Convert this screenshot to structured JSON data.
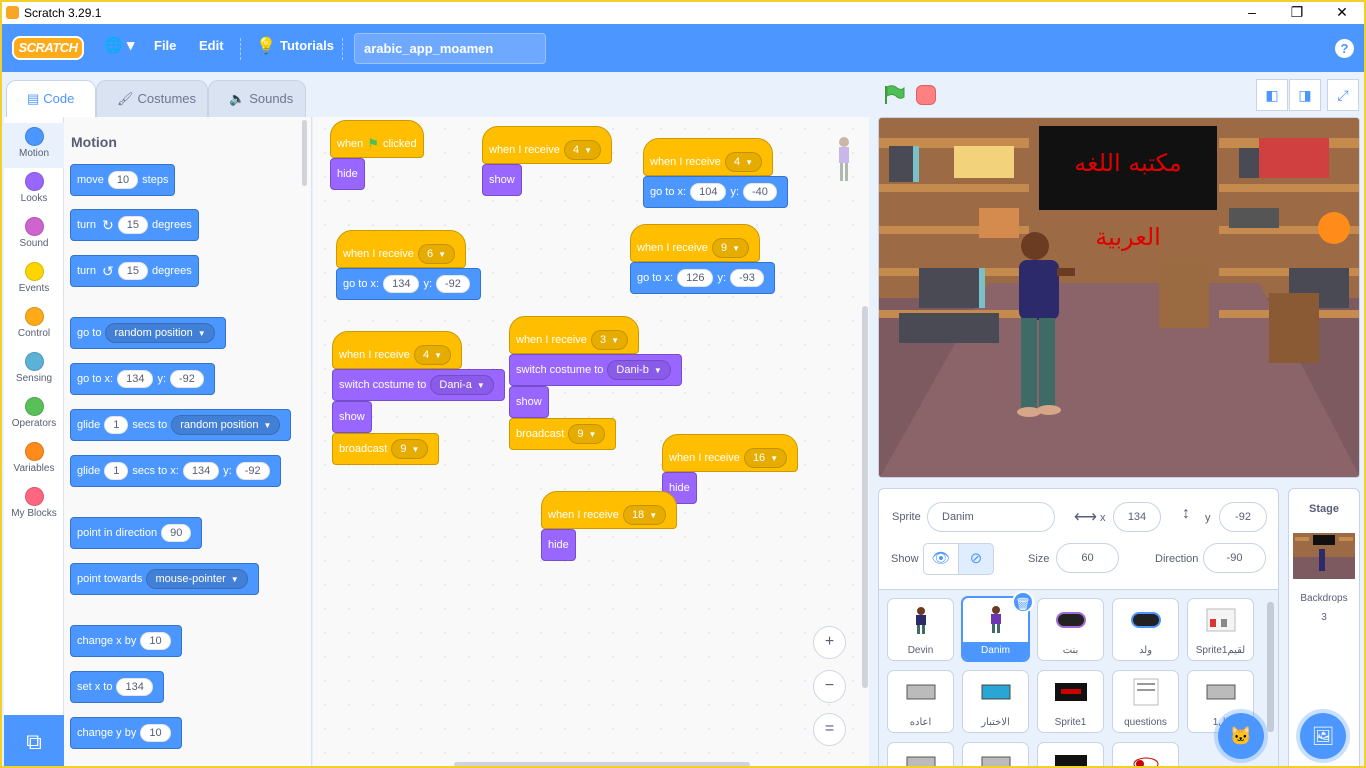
{
  "window": {
    "title": "Scratch 3.29.1",
    "minimize": "–",
    "restore": "❐",
    "close": "✕"
  },
  "menu": {
    "logo": "SCRATCH",
    "globe": "🌐 ▾",
    "file": "File",
    "edit": "Edit",
    "tutorials": "Tutorials",
    "project_name": "arabic_app_moamen",
    "help": "?"
  },
  "tabs": {
    "code": "Code",
    "costumes": "Costumes",
    "sounds": "Sounds"
  },
  "categories": [
    {
      "label": "Motion",
      "color": "#4c97ff"
    },
    {
      "label": "Looks",
      "color": "#9966ff"
    },
    {
      "label": "Sound",
      "color": "#cf63cf"
    },
    {
      "label": "Events",
      "color": "#ffd500"
    },
    {
      "label": "Control",
      "color": "#ffab19"
    },
    {
      "label": "Sensing",
      "color": "#5cb1d6"
    },
    {
      "label": "Operators",
      "color": "#59c059"
    },
    {
      "label": "Variables",
      "color": "#ff8c1a"
    },
    {
      "label": "My Blocks",
      "color": "#ff6680"
    }
  ],
  "palette": {
    "heading": "Motion",
    "move": {
      "a": "move",
      "v": "10",
      "b": "steps"
    },
    "turn_cw": {
      "a": "turn",
      "icon": "↻",
      "v": "15",
      "b": "degrees"
    },
    "turn_ccw": {
      "a": "turn",
      "icon": "↺",
      "v": "15",
      "b": "degrees"
    },
    "goto": {
      "a": "go to",
      "v": "random position"
    },
    "gotoxy": {
      "a": "go to x:",
      "x": "134",
      "b": "y:",
      "y": "-92"
    },
    "glide_to": {
      "a": "glide",
      "v": "1",
      "b": "secs to",
      "t": "random position"
    },
    "glide_xy": {
      "a": "glide",
      "v": "1",
      "b": "secs to x:",
      "x": "134",
      "c": "y:",
      "y": "-92"
    },
    "point_dir": {
      "a": "point in direction",
      "v": "90"
    },
    "point_towards": {
      "a": "point towards",
      "v": "mouse-pointer"
    },
    "change_x": {
      "a": "change x by",
      "v": "10"
    },
    "set_x": {
      "a": "set x to",
      "v": "134"
    },
    "change_y": {
      "a": "change y by",
      "v": "10"
    }
  },
  "scripts": {
    "s1": {
      "hat_a": "when",
      "hat_b": "clicked",
      "b1": "hide"
    },
    "s2": {
      "hat": "when I receive",
      "msg": "4",
      "b1": "show"
    },
    "s3": {
      "hat": "when I receive",
      "msg": "4",
      "b1a": "go to x:",
      "x": "104",
      "b1b": "y:",
      "y": "-40"
    },
    "s4": {
      "hat": "when I receive",
      "msg": "6",
      "b1a": "go to x:",
      "x": "134",
      "b1b": "y:",
      "y": "-92"
    },
    "s5": {
      "hat": "when I receive",
      "msg": "9",
      "b1a": "go to x:",
      "x": "126",
      "b1b": "y:",
      "y": "-93"
    },
    "s6": {
      "hat": "when I receive",
      "msg": "4",
      "b1": "switch costume to",
      "costume": "Dani-a",
      "b2": "show",
      "b3": "broadcast",
      "bmsg": "9"
    },
    "s7": {
      "hat": "when I receive",
      "msg": "3",
      "b1": "switch costume to",
      "costume": "Dani-b",
      "b2": "show",
      "b3": "broadcast",
      "bmsg": "9"
    },
    "s8": {
      "hat": "when I receive",
      "msg": "16",
      "b1": "hide"
    },
    "s9": {
      "hat": "when I receive",
      "msg": "18",
      "b1": "hide"
    }
  },
  "zoom": {
    "in": "+",
    "out": "−",
    "reset": "="
  },
  "stage": {
    "title": "مكتبه اللغه العربية"
  },
  "sprite_info": {
    "sprite_label": "Sprite",
    "name": "Danim",
    "x_label": "x",
    "x": "134",
    "y_label": "y",
    "y": "-92",
    "show_label": "Show",
    "size_label": "Size",
    "size": "60",
    "direction_label": "Direction",
    "direction": "-90"
  },
  "sprites": [
    {
      "name": "Devin"
    },
    {
      "name": "Danim"
    },
    {
      "name": "بنت"
    },
    {
      "name": "ولد"
    },
    {
      "name": "Sprite1لقيم"
    },
    {
      "name": "اعاده"
    },
    {
      "name": "الاختبار"
    },
    {
      "name": "Sprite1"
    },
    {
      "name": "questions"
    },
    {
      "name": "1ال"
    },
    {
      "name": ""
    },
    {
      "name": ""
    },
    {
      "name": ""
    },
    {
      "name": ""
    }
  ],
  "stage_panel": {
    "title": "Stage",
    "backdrops_label": "Backdrops",
    "backdrops_count": "3"
  }
}
